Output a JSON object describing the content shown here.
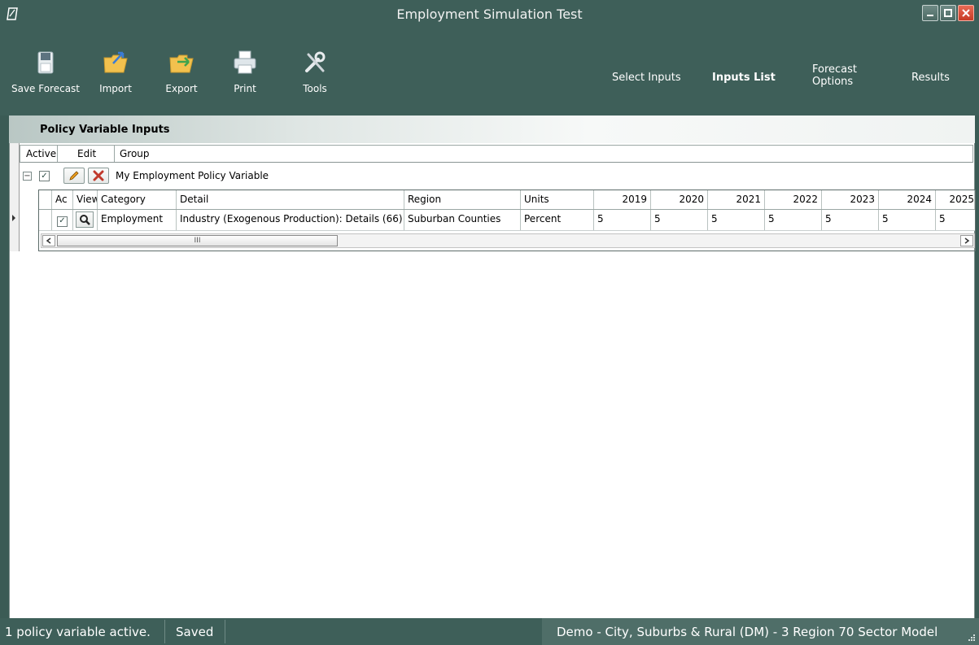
{
  "window": {
    "title": "Employment Simulation Test"
  },
  "toolbar": {
    "tools": [
      {
        "id": "save",
        "label": "Save Forecast",
        "icon": "floppy-disk-icon"
      },
      {
        "id": "import",
        "label": "Import",
        "icon": "folder-import-icon"
      },
      {
        "id": "export",
        "label": "Export",
        "icon": "folder-export-icon"
      },
      {
        "id": "print",
        "label": "Print",
        "icon": "printer-icon"
      },
      {
        "id": "tools",
        "label": "Tools",
        "icon": "wrench-screwdriver-icon"
      }
    ],
    "nav": {
      "select_inputs": "Select Inputs",
      "inputs_list": "Inputs List",
      "forecast_options_line1": "Forecast",
      "forecast_options_line2": "Options",
      "results": "Results"
    }
  },
  "section": {
    "title": "Policy Variable Inputs"
  },
  "outer_grid": {
    "headers": {
      "active": "Active",
      "edit": "Edit",
      "group": "Group"
    },
    "group_row": {
      "group_name": "My Employment Policy Variable",
      "active": true
    }
  },
  "inner_grid": {
    "headers": {
      "active": "Ac",
      "view": "View",
      "category": "Category",
      "detail": "Detail",
      "region": "Region",
      "units": "Units",
      "y2019": "2019",
      "y2020": "2020",
      "y2021": "2021",
      "y2022": "2022",
      "y2023": "2023",
      "y2024": "2024",
      "y2025": "2025"
    },
    "row": {
      "active": true,
      "category": "Employment",
      "detail": "Industry (Exogenous Production): Details (66)",
      "region": "Suburban Counties",
      "units": "Percent",
      "y2019": "5",
      "y2020": "5",
      "y2021": "5",
      "y2022": "5",
      "y2023": "5",
      "y2024": "5",
      "y2025": "5"
    },
    "scroll": {
      "thumb_label": "III"
    }
  },
  "status": {
    "active_count": "1 policy variable active.",
    "save_state": "Saved",
    "model_info": "Demo - City, Suburbs & Rural (DM) -  3 Region 70 Sector Model"
  },
  "colors": {
    "chrome": "#3e5f59",
    "status_right": "#4f6e68",
    "delete_red": "#c0392b"
  }
}
